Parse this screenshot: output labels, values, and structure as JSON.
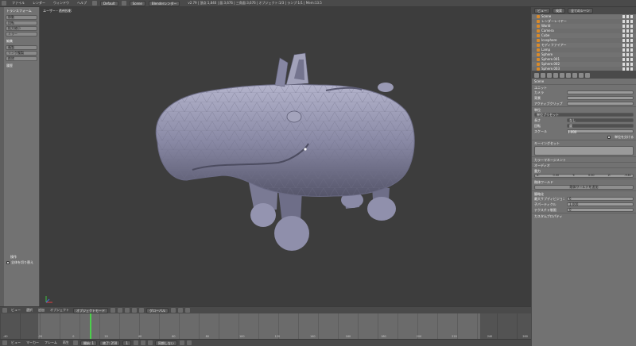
{
  "topbar": {
    "menus": [
      "ファイル",
      "レンダー",
      "ウィンドウ",
      "ヘルプ"
    ],
    "layout": "Default",
    "scene": "Scene",
    "engine": "Blenderレンダー",
    "stats": "v2.79 | 頂点:1,840 | 面:3,676 | 三角面:3,676 | オブジェクト:1/3 | ランプ:1/1 | Mem:13.5"
  },
  "toolshelf": {
    "section_transform": "トランスフォーム",
    "buttons_transform": [
      "移動",
      "回転",
      "拡大縮小",
      "ミラー"
    ],
    "section_edit": "編集",
    "buttons_edit": [
      "複製",
      "リンク複製",
      "削除"
    ],
    "section_history": "履歴",
    "bottom_section": "操作",
    "bottom_item": "全体を切り替え"
  },
  "viewport": {
    "label": "ユーザー・透視投影"
  },
  "viewport_header": {
    "menus": [
      "ビュー",
      "選択",
      "追加",
      "オブジェクト"
    ],
    "mode": "オブジェクトモード",
    "pivot": "グローバル"
  },
  "timeline": {
    "numbers": [
      "-40",
      "-20",
      "0",
      "20",
      "40",
      "60",
      "80",
      "100",
      "120",
      "140",
      "160",
      "180",
      "200",
      "220",
      "240",
      "260"
    ],
    "current_frame": 1
  },
  "timeline_header": {
    "menus": [
      "ビュー",
      "マーカー",
      "フレーム",
      "再生"
    ],
    "start": "開始: 1",
    "end": "終了: 250",
    "frame": "1",
    "sync": "同期しない"
  },
  "outliner": {
    "menus": [
      "ビュー",
      "検索"
    ],
    "filter": "全てのシーン",
    "rows": [
      "Scene",
      "レンダーレイヤー",
      "World",
      "Camera",
      "Cube",
      "Icosphere",
      "モディファイアー",
      "Lamp",
      "Sphere",
      "Sphere.001",
      "Sphere.002",
      "Sphere.003"
    ]
  },
  "properties": {
    "object_name": "Scene",
    "section_units": "ユニット",
    "rows_units": [
      "カメラ",
      "背景",
      "アクティブクリップ"
    ],
    "section_units2": "単位",
    "unit_preset": "単位プリセット",
    "rows_units3": [
      [
        "長さ",
        "なし"
      ],
      [
        "回転",
        "度"
      ],
      [
        "スケール",
        "1.000"
      ]
    ],
    "separate_units": "単位を分ける",
    "keying": "キーイングセット",
    "color_management": "カラーマネージメント",
    "audio": "オーディオ",
    "gravity": "重力",
    "gravity_values": [
      "X:",
      "0.00",
      "Y:",
      "0.00",
      "Z:",
      "-9.81"
    ],
    "rigid_world": "剛体ワールド",
    "add_rigid_world": "剛体ワールドを追加",
    "simplify": "簡略化",
    "simplify_rows": [
      [
        "最大サブディビジョン",
        "6"
      ],
      [
        "子パーティクル",
        "1.000"
      ],
      [
        "テクスチャ制限",
        "0"
      ]
    ],
    "custom_props": "カスタムプロパティ"
  },
  "colors": {
    "viewport_bg": "#3d3d3d",
    "mesh": "#8a8aa6",
    "timeline_cursor": "#4bd04b",
    "panel": "#727272"
  }
}
